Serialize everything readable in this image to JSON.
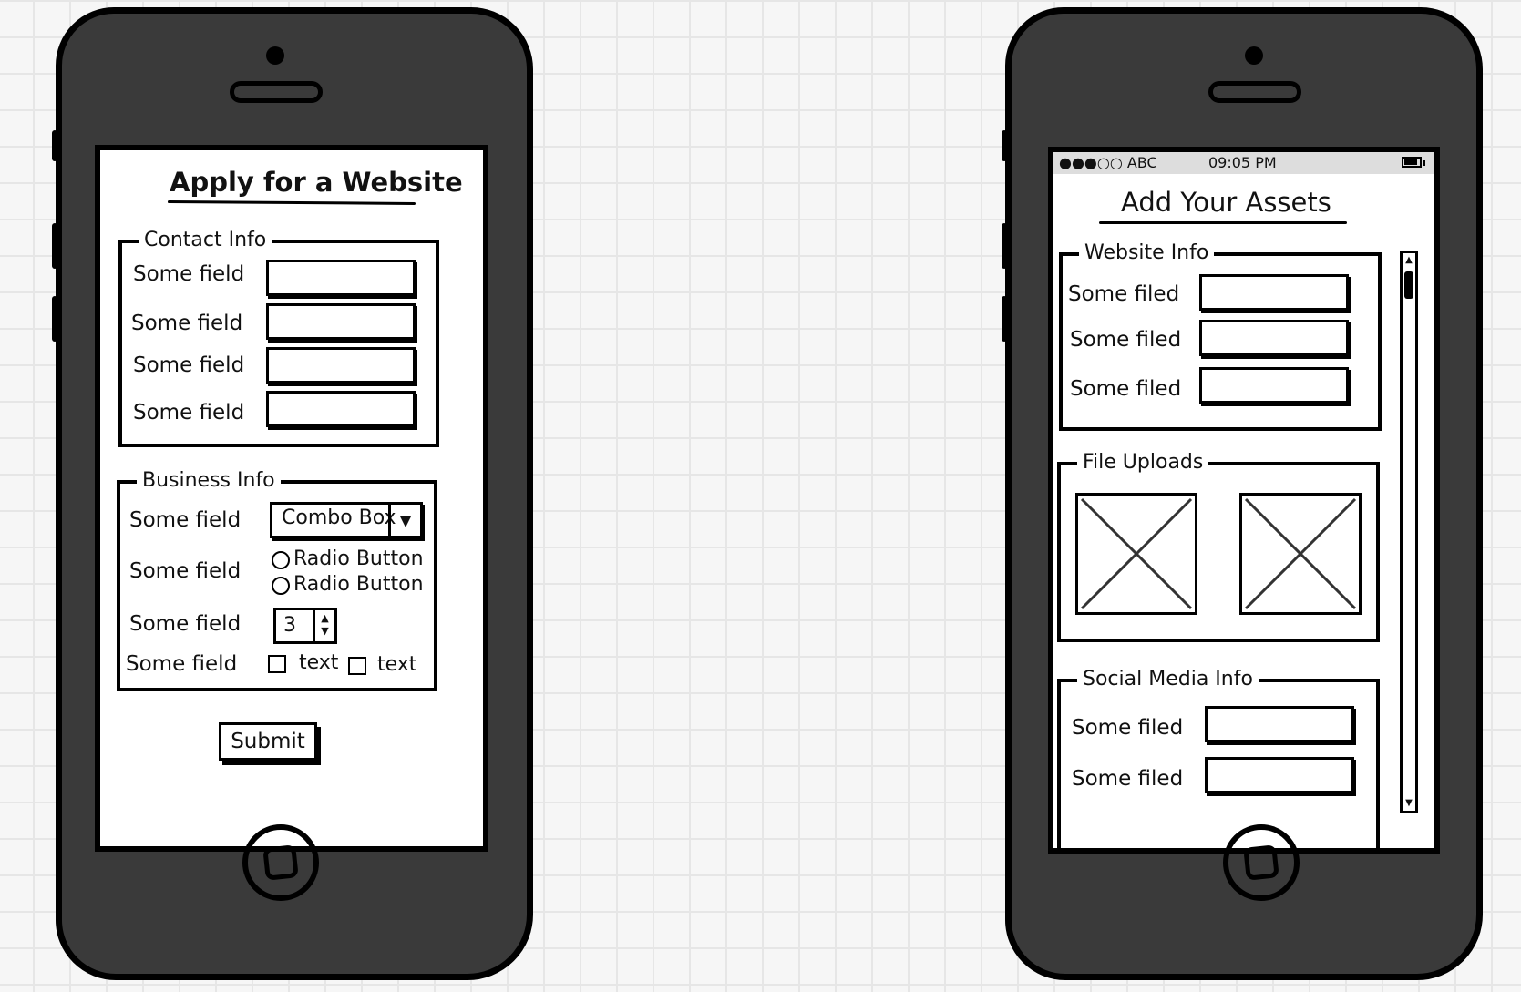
{
  "left": {
    "title": "Apply for a Website",
    "contact": {
      "legend": "Contact Info",
      "fields": [
        "Some field",
        "Some field",
        "Some field",
        "Some field"
      ]
    },
    "business": {
      "legend": "Business Info",
      "combo_label": "Some field",
      "combo_value": "Combo Box",
      "radio_label": "Some field",
      "radio_options": [
        "Radio Button",
        "Radio Button"
      ],
      "stepper_label": "Some field",
      "stepper_value": "3",
      "checkbox_label": "Some field",
      "checkbox_options": [
        "text",
        "text"
      ]
    },
    "submit_label": "Submit"
  },
  "right": {
    "status": {
      "carrier": "●●●○○ ABC",
      "time": "09:05 PM"
    },
    "title": "Add Your Assets",
    "website": {
      "legend": "Website Info",
      "fields": [
        "Some filed",
        "Some filed",
        "Some filed"
      ]
    },
    "uploads": {
      "legend": "File Uploads"
    },
    "social": {
      "legend": "Social Media Info",
      "fields": [
        "Some filed",
        "Some filed"
      ]
    }
  },
  "icons": {
    "dropdown": "triangle-down",
    "stepper": "up-down-arrows",
    "image_placeholder": "cross-box",
    "battery": "battery"
  }
}
